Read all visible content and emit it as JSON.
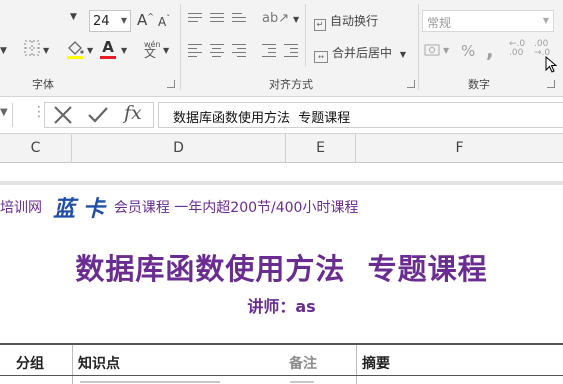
{
  "ribbon": {
    "font_size": "24",
    "font_group_label": "字体",
    "align_group_label": "对齐方式",
    "number_group_label": "数字",
    "wrap_text_label": "自动换行",
    "merge_center_label": "合并后居中",
    "number_format_value": "常规",
    "percent_symbol": "%",
    "comma_symbol": ",",
    "increase_decimal_text": ".00",
    "decrease_decimal_text": ".0",
    "increase_font_glyph": "A",
    "decrease_font_glyph": "A",
    "font_color_glyph": "A",
    "phonetic_glyph": "文"
  },
  "formula_bar": {
    "content": "数据库函数使用方法  专题课程",
    "fx_label": "fx"
  },
  "columns": [
    "C",
    "D",
    "E",
    "F"
  ],
  "sheet": {
    "banner_prefix": "培训网",
    "banner_logo": "蓝 卡",
    "banner_suffix": "会员课程 一年内超200节/400小时课程",
    "title": "数据库函数使用方法  专题课程",
    "lecturer": "讲师：as",
    "headers": [
      "分组",
      "知识点",
      "备注",
      "摘要"
    ]
  },
  "colors": {
    "purple": "#6a2c91",
    "logo_blue": "#1f4ea8",
    "font_color_bar": "#e81c23"
  }
}
